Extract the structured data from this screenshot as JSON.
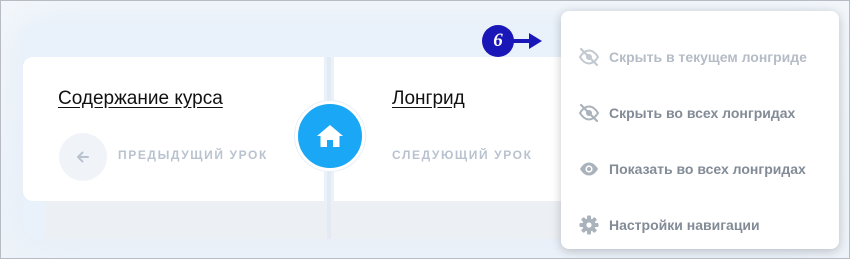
{
  "navigation": {
    "prev_lesson": {
      "title": "Содержание курса",
      "label": "ПРЕДЫДУЩИЙ УРОК",
      "icon": "arrow-left-icon"
    },
    "next_lesson": {
      "title": "Лонгрид",
      "label": "СЛЕДУЮЩИЙ УРОК"
    },
    "home_icon": "home-icon"
  },
  "annotation": {
    "step_number": "6"
  },
  "context_menu": {
    "items": [
      {
        "label": "Скрыть в текущем лонгриде",
        "icon": "eye-off-icon",
        "disabled": true
      },
      {
        "label": "Скрыть во всех лонгридах",
        "icon": "eye-off-icon",
        "disabled": false
      },
      {
        "label": "Показать во всех лонгридах",
        "icon": "eye-icon",
        "disabled": false
      },
      {
        "label": "Настройки навигации",
        "icon": "gear-icon",
        "disabled": false
      }
    ]
  },
  "colors": {
    "home_button": "#1aa7f5",
    "step_badge": "#1a17b8",
    "menu_text": "#828b96",
    "menu_text_disabled": "#b5bcc6"
  }
}
